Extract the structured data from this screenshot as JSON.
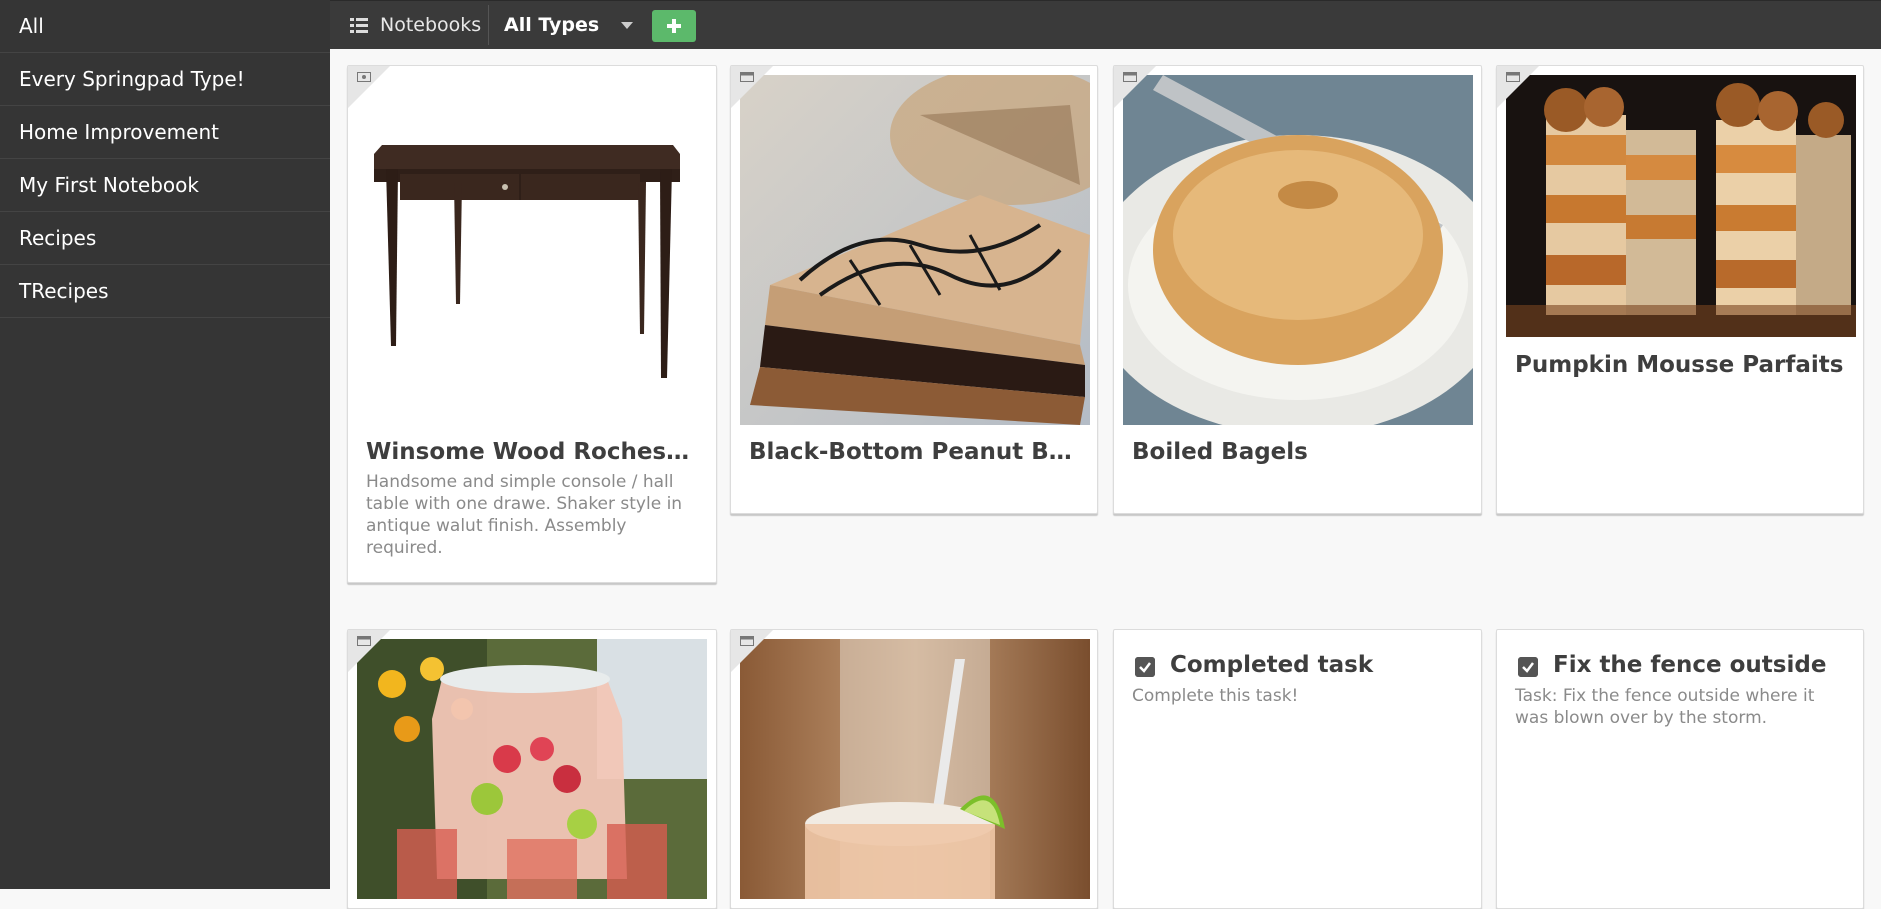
{
  "sidebar": {
    "items": [
      {
        "label": "All"
      },
      {
        "label": "Every Springpad Type!"
      },
      {
        "label": "Home Improvement"
      },
      {
        "label": "My First Notebook"
      },
      {
        "label": "Recipes"
      },
      {
        "label": "TRecipes"
      }
    ]
  },
  "toolbar": {
    "notebooks_label": "Notebooks",
    "types_label": "All Types",
    "add_icon": "plus-icon",
    "add_color": "#5cb96b"
  },
  "cards": [
    {
      "title": "Winsome Wood Rochester ...",
      "description": "Handsome and simple console / hall table with one drawe. Shaker style in antique walut finish. Assembly required.",
      "image": "wooden-console-table",
      "type_icon": "product-icon"
    },
    {
      "title": "Black-Bottom Peanut Butte...",
      "image": "peanut-butter-pie-slice",
      "type_icon": "recipe-icon"
    },
    {
      "title": "Boiled Bagels",
      "image": "bagel-on-plate",
      "type_icon": "recipe-icon"
    },
    {
      "title": "Pumpkin Mousse Parfaits",
      "image": "pumpkin-parfait-glasses",
      "type_icon": "recipe-icon"
    },
    {
      "image": "fruit-punch-jar",
      "type_icon": "recipe-icon"
    },
    {
      "image": "margarita-jar-with-lime",
      "type_icon": "recipe-icon"
    },
    {
      "title": "Completed task",
      "description": "Complete this task!",
      "type_icon": "checkbox-icon"
    },
    {
      "title": "Fix the fence outside",
      "description": "Task: Fix the fence outside where it was blown over by the storm.",
      "type_icon": "checkbox-icon"
    }
  ]
}
